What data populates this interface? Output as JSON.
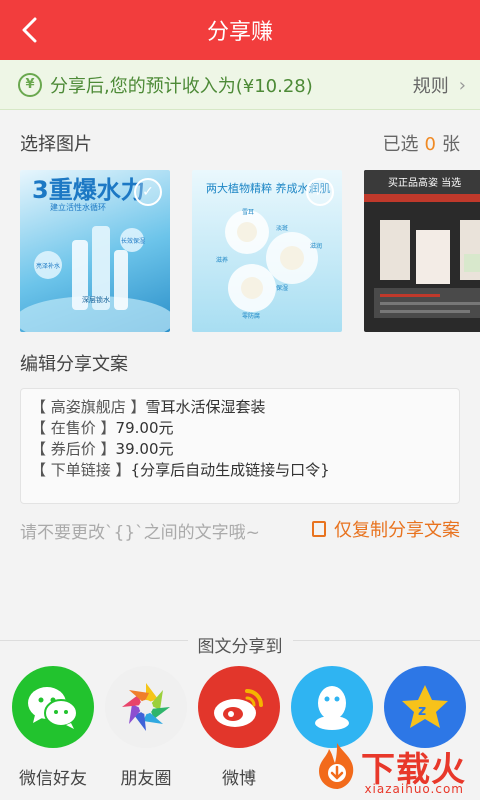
{
  "header": {
    "title": "分享赚"
  },
  "earnings": {
    "text": "分享后,您的预计收入为(¥10.28)",
    "rules_label": "规则",
    "yen_symbol": "¥"
  },
  "select": {
    "label": "选择图片",
    "count_prefix": "已选",
    "count": "0",
    "count_suffix": "张"
  },
  "images": [
    {
      "texts": [
        "3重爆水力",
        "建立活性水循环",
        "亮泽补水",
        "长效保湿",
        "深层锁水"
      ],
      "selected": false
    },
    {
      "texts": [
        "两大植物精粹 养成水润肌",
        "雪耳",
        "淡斑",
        "滋养",
        "滋润",
        "保湿",
        "零防腐"
      ],
      "selected": false
    },
    {
      "texts": [
        "买正品高姿 当选"
      ],
      "selected": false
    }
  ],
  "edit": {
    "label": "编辑分享文案",
    "lines": [
      {
        "bracket": "【 高姿旗舰店 】",
        "text": "雪耳水活保湿套装"
      },
      {
        "bracket": "【 在售价 】",
        "text": "79.00元"
      },
      {
        "bracket": "【 券后价 】",
        "text": "39.00元"
      },
      {
        "bracket": "【 下单链接 】",
        "text": "{分享后自动生成链接与口令}"
      }
    ]
  },
  "tip": "请不要更改`{}`之间的文字哦~",
  "copy_label": "仅复制分享文案",
  "share": {
    "title": "图文分享到",
    "targets": [
      {
        "label": "微信好友",
        "color": "#22c32e",
        "icon": "wechat-icon"
      },
      {
        "label": "朋友圈",
        "color": "#f0f0f0",
        "icon": "moments-icon"
      },
      {
        "label": "微博",
        "color": "#e2362b",
        "icon": "weibo-icon"
      },
      {
        "label": "",
        "color": "#2fb4f2",
        "icon": "qq-icon"
      },
      {
        "label": "",
        "color": "#2d77e6",
        "icon": "qzone-icon"
      }
    ]
  },
  "watermark": {
    "brand": "下载火",
    "site": "xiazaihuo.com"
  }
}
